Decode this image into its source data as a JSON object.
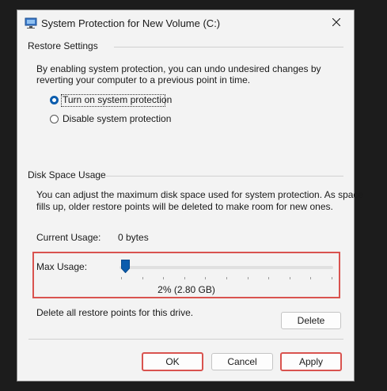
{
  "window": {
    "title": "System Protection for New Volume (C:)",
    "app_icon": "system-properties-icon",
    "close_icon": "close-icon"
  },
  "restore_settings": {
    "group_title": "Restore Settings",
    "description_line1": "By enabling system protection, you can undo undesired changes by",
    "description_line2": "reverting your computer to a previous point in time.",
    "options": [
      {
        "label": "Turn on system protection",
        "selected": true
      },
      {
        "label": "Disable system protection",
        "selected": false
      }
    ]
  },
  "disk_space": {
    "group_title": "Disk Space Usage",
    "description_line1": "You can adjust the maximum disk space used for system protection. As space",
    "description_line2": "fills up, older restore points will be deleted to make room for new ones.",
    "current_usage_label": "Current Usage:",
    "current_usage_value": "0 bytes",
    "max_usage_label": "Max Usage:",
    "max_usage_percent": 2,
    "max_usage_value": "2% (2.80 GB)",
    "delete_text": "Delete all restore points for this drive.",
    "delete_button": "Delete"
  },
  "buttons": {
    "ok": "OK",
    "cancel": "Cancel",
    "apply": "Apply"
  },
  "colors": {
    "accent": "#0b5cad",
    "highlight": "#d9534f"
  }
}
